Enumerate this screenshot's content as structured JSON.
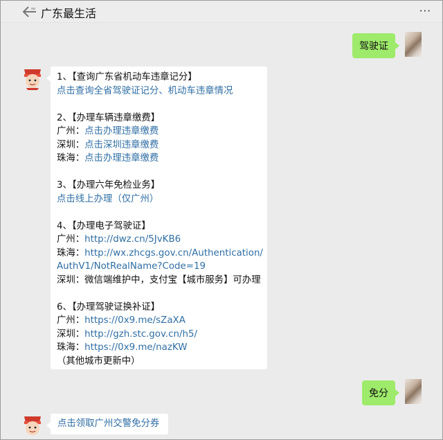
{
  "header": {
    "title": "广东最生活",
    "more_label": "···"
  },
  "messages": {
    "user_1": "驾驶证",
    "user_2": "免分",
    "bot_2": "点击领取广州交警免分券"
  },
  "bot_reply": {
    "s1": {
      "heading": "1、【查询广东省机动车违章记分】",
      "link": "点击查询全省驾驶证记分、机动车违章情况"
    },
    "s2": {
      "heading": "2、【办理车辆违章缴费】",
      "gz_label": "广州：",
      "gz_link": "点击办理违章缴费",
      "sz_label": "深圳：",
      "sz_link": "点击深圳违章缴费",
      "zh_label": "珠海：",
      "zh_link": "点击办理违章缴费"
    },
    "s3": {
      "heading": "3、【办理六年免检业务】",
      "link": "点击线上办理（仅广州）"
    },
    "s4": {
      "heading": "4、【办理电子驾驶证】",
      "gz_label": "广州：",
      "gz_link": "http://dwz.cn/5JvKB6",
      "zh_label": "珠海：",
      "zh_link_1": "http://wx.zhcgs.gov.cn/Authentication/",
      "zh_link_2": "AuthV1/NotRealName?Code=19",
      "sz_text": "深圳：微信端维护中，支付宝【城市服务】可办理"
    },
    "s6": {
      "heading": "6、【办理驾驶证换补证】",
      "gz_label": "广州：",
      "gz_link": "https://0x9.me/sZaXA",
      "sz_label": "深圳：",
      "sz_link": "http://gzh.stc.gov.cn/h5/",
      "zh_label": "珠海：",
      "zh_link": "https://0x9.me/nazKW",
      "note": "（其他城市更新中）"
    }
  },
  "colors": {
    "link": "#2f6ea3",
    "user_bubble": "#9eea6a",
    "background": "#ebebeb"
  },
  "icons": [
    "back-arrow-icon",
    "more-icon",
    "user-avatar",
    "bot-avatar"
  ]
}
